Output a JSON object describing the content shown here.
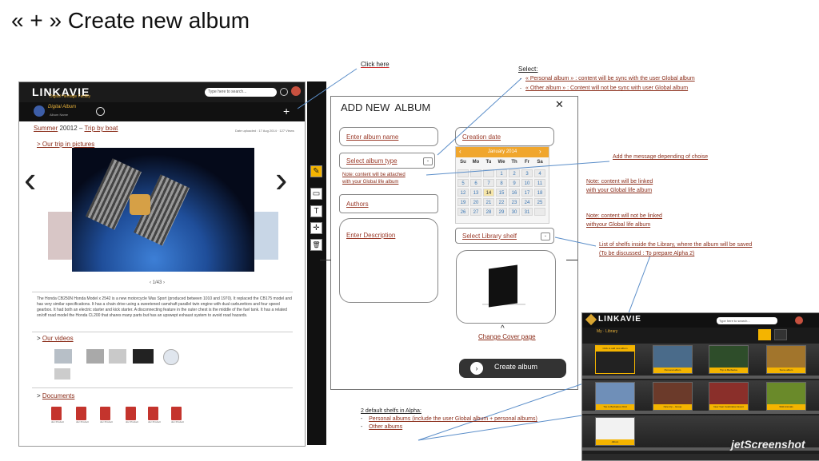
{
  "slide_title": "« + » Create new album",
  "left_app": {
    "logo": "LINKAVIE",
    "logo_sub": "Digital Heritage Facility",
    "search_placeholder": "Type here to search...",
    "album_badge": "Digital Album",
    "album_badge_sub": "Album Name",
    "plus": "+",
    "breadcrumb_part1": "Summer",
    "breadcrumb_year": " 20012 – ",
    "breadcrumb_part2": "Trip by boat",
    "meta": "Date uploaded : 17 Aug 2014 · 127 Views",
    "sub_link": "> Our trip in pictures",
    "pager": "‹  1/43  ›",
    "description": "The Honda CB250N Honda Model x 2542 is a new motorcycle Was Sport (produced between 1010 and 1970). It replaced the CB175 model and has very similar specifications. It has a chain drive using a sweetened camshaft parallel twin engine with dual carburettors and four speed gearbox. It had both an electric starter and kick starter. A disconnecting feature in the outer chest is the middle of the fuel tank. It has a related on/off road model the Honda CL200 that shares many parts but has an upswept exhaust system to avoid road hazards.",
    "videos_prefix": "> ",
    "videos_label": "Our videos",
    "documents_prefix": "> ",
    "documents_label": "Documents",
    "doc_labels": [
      "doc Product",
      "doc Product",
      "doc Product",
      "doc Product",
      "doc Product",
      "doc Product"
    ],
    "tools": [
      "✎",
      "▭",
      "T",
      "✛",
      "🗑"
    ]
  },
  "modal": {
    "title_a": "ADD NEW",
    "title_b": "ALBUM",
    "close": "✕",
    "album_name_placeholder": "Enter album name",
    "creation_date_placeholder": "Creation date",
    "album_type_placeholder": "Select album type",
    "caret": "⌄",
    "note_prefix": "Note",
    "note_text": ": content will be attached",
    "note_text2": "with your Global life album",
    "authors_placeholder": "Authors",
    "description_placeholder": "Enter Description",
    "library_shelf_placeholder": "Select Library shelf",
    "change_cover": "Change Cover page",
    "change_cover_caret": "^",
    "create_button": "Create album",
    "create_icon": "›",
    "calendar": {
      "month": "January 2014",
      "prev": "‹",
      "next": "›",
      "day_names": [
        "Su",
        "Mo",
        "Tu",
        "We",
        "Th",
        "Fr",
        "Sa"
      ],
      "weeks": [
        [
          "",
          "",
          "",
          "1",
          "2",
          "3",
          "4"
        ],
        [
          "5",
          "6",
          "7",
          "8",
          "9",
          "10",
          "11"
        ],
        [
          "12",
          "13",
          "14",
          "15",
          "16",
          "17",
          "18"
        ],
        [
          "19",
          "20",
          "21",
          "22",
          "23",
          "24",
          "25"
        ],
        [
          "26",
          "27",
          "28",
          "29",
          "30",
          "31",
          ""
        ]
      ],
      "highlight": "14"
    }
  },
  "annotations": {
    "click_here": "Click here",
    "select_title": "Select:",
    "select_item1_a": "« Personal album » : ",
    "select_item1_b": "content will be sync with the user Global album",
    "select_item2_a": "« Other album » : ",
    "select_item2_b": "Content will not be sync with user Global album",
    "add_message": "Add the message depending of choise",
    "note_linked": "Note: content will be linked",
    "note_linked2": "with your Global life album",
    "note_not_linked": "Note: content will not be linked",
    "note_not_linked2": "withyour Global life album",
    "shelves_line1": "List of shelfs inside the Library, where the album will be saved",
    "shelves_line2": "(To be discussed : To prepare Alpha 2)",
    "default_title": "2 default shelfs in Alpha:",
    "default_item1": "Personal albums (include the user Global album + personal albums)",
    "default_item2": "Other albums"
  },
  "right_app": {
    "logo": "LINKAVIE",
    "search_placeholder": "Type here to search...",
    "sub": "My · Library",
    "row1_caps": [
      "Click to add new album",
      "Personal album",
      "Trip to Barbados",
      "Some album"
    ],
    "row2_caps": [
      "Trip to Barbados 2014",
      "Nice trip – Group",
      "New Year Celebration Event",
      "Wild Animals"
    ],
    "row3_caps": [
      "Album"
    ]
  },
  "watermark": "jetScreenshot",
  "colors": {
    "accent": "#f4b400",
    "link": "#8b2d1a",
    "dark": "#1b1b1b"
  }
}
